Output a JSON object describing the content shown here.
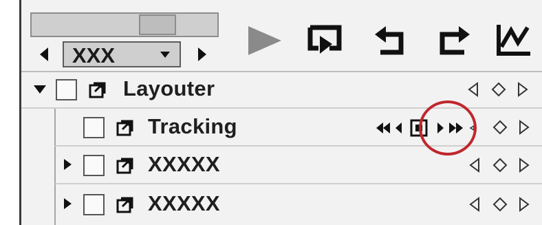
{
  "toolbar": {
    "selector": {
      "value": "XXX"
    },
    "buttons": [
      "play",
      "loop",
      "undo",
      "redo",
      "graph"
    ]
  },
  "tree": {
    "rows": [
      {
        "label": "Layouter",
        "expanded": true,
        "checked": false,
        "icon": "layer-icon",
        "level": 0
      },
      {
        "label": "Tracking",
        "checked": false,
        "icon": "layer-icon",
        "level": 1,
        "has_tracking_controls": true
      },
      {
        "label": "XXXXX",
        "expanded": false,
        "checked": false,
        "icon": "layer-icon",
        "level": 1
      },
      {
        "label": "XXXXX",
        "expanded": false,
        "checked": false,
        "icon": "layer-icon",
        "level": 1
      }
    ]
  },
  "tracking_controls": [
    "fast-backward",
    "step-backward",
    "track-frame",
    "step-forward",
    "fast-forward"
  ],
  "keyframe_nav": [
    "prev-keyframe",
    "add-keyframe",
    "next-keyframe"
  ],
  "annotation": {
    "color": "#c0272d",
    "target": "fast-forward"
  },
  "colors": {
    "panel_bg": "#f2f2f2",
    "icon_dark": "#1a1a1a",
    "play_gray": "#8a8a8a",
    "highlight_red": "#c0272d"
  }
}
